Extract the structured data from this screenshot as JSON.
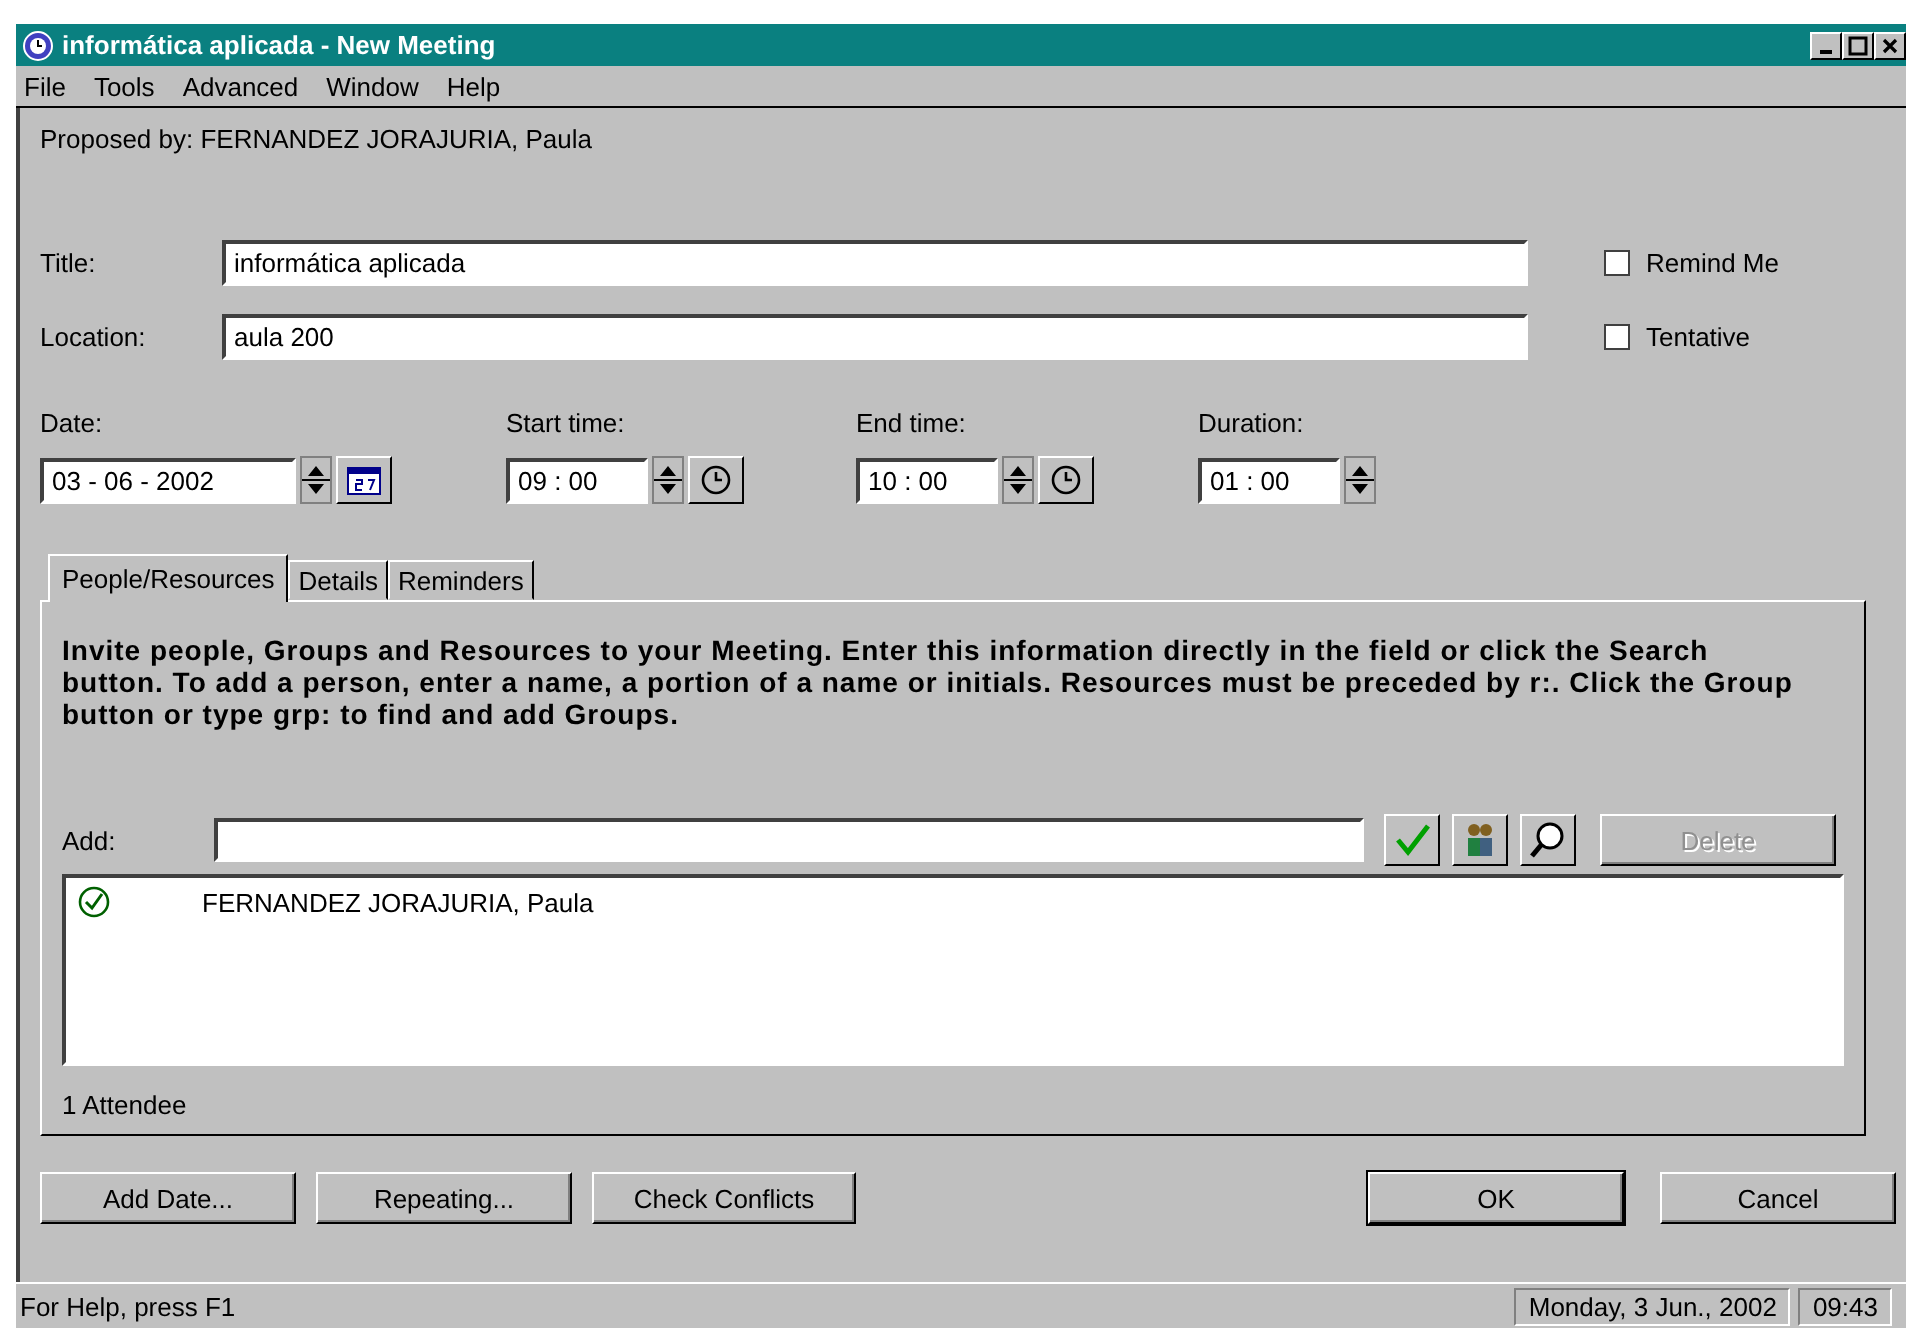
{
  "window": {
    "title": "informática aplicada - New Meeting"
  },
  "menu": [
    "File",
    "Tools",
    "Advanced",
    "Window",
    "Help"
  ],
  "proposed_by": "Proposed by: FERNANDEZ JORAJURIA, Paula",
  "fields": [
    {
      "label": "Title:",
      "value": "informática aplicada"
    },
    {
      "label": "Location:",
      "value": "aula 200"
    }
  ],
  "options": [
    {
      "label": "Remind Me",
      "checked": false
    },
    {
      "label": "Tentative",
      "checked": false
    }
  ],
  "times": [
    {
      "label": "Date:",
      "value": "03 - 06 - 2002",
      "kind": "date"
    },
    {
      "label": "Start time:",
      "value": "09 : 00",
      "kind": "time"
    },
    {
      "label": "End time:",
      "value": "10 : 00",
      "kind": "time"
    },
    {
      "label": "Duration:",
      "value": "01 : 00",
      "kind": "duration"
    }
  ],
  "tabs": [
    {
      "label": "People/Resources",
      "selected": true
    },
    {
      "label": "Details",
      "selected": false
    },
    {
      "label": "Reminders",
      "selected": false
    }
  ],
  "instructions": "Invite people, Groups and Resources to your Meeting. Enter this information directly in the field or click the Search button. To add a person, enter a name, a portion of a name or initials. Resources must be preceded by r:. Click the Group button or type grp: to find and add Groups.",
  "add": {
    "label": "Add:",
    "delete_button": {
      "label": "Delete",
      "disabled": true
    }
  },
  "attendees": [
    {
      "name": "FERNANDEZ JORAJURIA, Paula",
      "accepted": true
    }
  ],
  "attendee_count": "1 Attendee",
  "buttons_left": [
    "Add Date...",
    "Repeating...",
    "Check Conflicts"
  ],
  "buttons_right": [
    "OK",
    "Cancel"
  ],
  "status_bar": {
    "help": "For Help, press F1",
    "date": "Monday, 3 Jun., 2002",
    "time": "09:43"
  }
}
